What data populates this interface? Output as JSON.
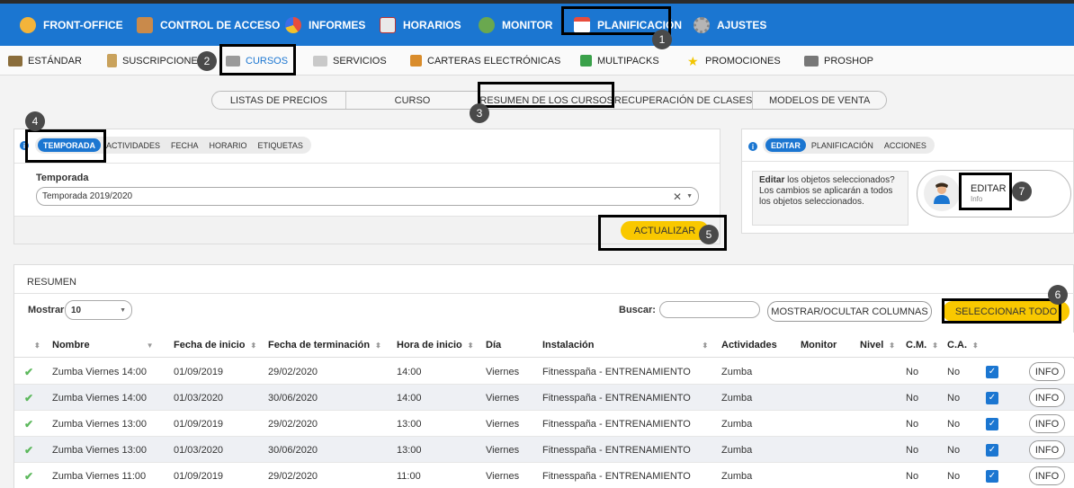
{
  "top_nav": {
    "items": [
      {
        "label": "FRONT-OFFICE",
        "icon": "user-icon",
        "color": "#f3b43a"
      },
      {
        "label": "CONTROL DE ACCESO",
        "icon": "access-icon",
        "color": "#c98a4b"
      },
      {
        "label": "INFORMES",
        "icon": "pie-chart-icon",
        "color": "#e84d3d"
      },
      {
        "label": "HORARIOS",
        "icon": "schedule-icon",
        "color": "#e9e9e9"
      },
      {
        "label": "MONITOR",
        "icon": "people-icon",
        "color": "#6aa84f"
      },
      {
        "label": "PLANIFICACIÓN",
        "icon": "calendar-icon",
        "color": "#e84d3d"
      },
      {
        "label": "AJUSTES",
        "icon": "gear-icon",
        "color": "#b5b5b5"
      }
    ]
  },
  "sub_nav": {
    "items": [
      {
        "label": "ESTÁNDAR",
        "color": "#8a6d3b"
      },
      {
        "label": "SUSCRIPCIONES",
        "color": "#c9a25c"
      },
      {
        "label": "CURSOS",
        "color": "#9a9a9a"
      },
      {
        "label": "SERVICIOS",
        "color": "#c9c9c9"
      },
      {
        "label": "CARTERAS ELECTRÓNICAS",
        "color": "#d98c2b"
      },
      {
        "label": "MULTIPACKS",
        "color": "#3aa14a"
      },
      {
        "label": "PROMOCIONES",
        "color": "#f2c500"
      },
      {
        "label": "PROSHOP",
        "color": "#777777"
      }
    ]
  },
  "view_tabs": [
    "LISTAS DE PRECIOS",
    "CURSO",
    "RESUMEN DE LOS CURSOS",
    "RECUPERACIÓN DE CLASES",
    "MODELOS DE VENTA"
  ],
  "filter_panel": {
    "tabs": [
      "TEMPORADA",
      "ACTIVIDADES",
      "FECHA",
      "HORARIO",
      "ETIQUETAS"
    ],
    "field_label": "Temporada",
    "field_value": "Temporada 2019/2020",
    "update_button": "ACTUALIZAR"
  },
  "edit_panel": {
    "tabs": [
      "EDITAR",
      "PLANIFICACIÓN",
      "ACCIONES"
    ],
    "description_bold": "Editar",
    "description": " los objetos seleccionados? Los cambios se aplicarán a todos los objetos seleccionados.",
    "card_title": "EDITAR",
    "card_subtitle": "Info"
  },
  "summary": {
    "title": "RESUMEN",
    "show_label": "Mostrar",
    "show_value": "10",
    "search_label": "Buscar:",
    "toggle_columns_button": "MOSTRAR/OCULTAR COLUMNAS",
    "select_all_button": "SELECCIONAR TODO",
    "columns": [
      "Nombre",
      "Fecha de inicio",
      "Fecha de terminación",
      "Hora de inicio",
      "Día",
      "Instalación",
      "Actividades",
      "Monitor",
      "Nivel",
      "C.M.",
      "C.A."
    ],
    "rows": [
      {
        "nombre": "Zumba Viernes 14:00",
        "inicio": "01/09/2019",
        "fin": "29/02/2020",
        "hora": "14:00",
        "dia": "Viernes",
        "instalacion": "Fitnesspaña - ENTRENAMIENTO",
        "actividad": "Zumba",
        "cm": "No",
        "ca": "No",
        "info": "INFO"
      },
      {
        "nombre": "Zumba Viernes 14:00",
        "inicio": "01/03/2020",
        "fin": "30/06/2020",
        "hora": "14:00",
        "dia": "Viernes",
        "instalacion": "Fitnesspaña - ENTRENAMIENTO",
        "actividad": "Zumba",
        "cm": "No",
        "ca": "No",
        "info": "INFO"
      },
      {
        "nombre": "Zumba Viernes 13:00",
        "inicio": "01/09/2019",
        "fin": "29/02/2020",
        "hora": "13:00",
        "dia": "Viernes",
        "instalacion": "Fitnesspaña - ENTRENAMIENTO",
        "actividad": "Zumba",
        "cm": "No",
        "ca": "No",
        "info": "INFO"
      },
      {
        "nombre": "Zumba Viernes 13:00",
        "inicio": "01/03/2020",
        "fin": "30/06/2020",
        "hora": "13:00",
        "dia": "Viernes",
        "instalacion": "Fitnesspaña - ENTRENAMIENTO",
        "actividad": "Zumba",
        "cm": "No",
        "ca": "No",
        "info": "INFO"
      },
      {
        "nombre": "Zumba Viernes 11:00",
        "inicio": "01/09/2019",
        "fin": "29/02/2020",
        "hora": "11:00",
        "dia": "Viernes",
        "instalacion": "Fitnesspaña - ENTRENAMIENTO",
        "actividad": "Zumba",
        "cm": "No",
        "ca": "No",
        "info": "INFO"
      }
    ]
  },
  "annotations": [
    "1",
    "2",
    "3",
    "4",
    "5",
    "6",
    "7"
  ],
  "colors": {
    "primary": "#1b76d1",
    "accent_yellow": "#f9c800",
    "check_green": "#5cb85c"
  }
}
